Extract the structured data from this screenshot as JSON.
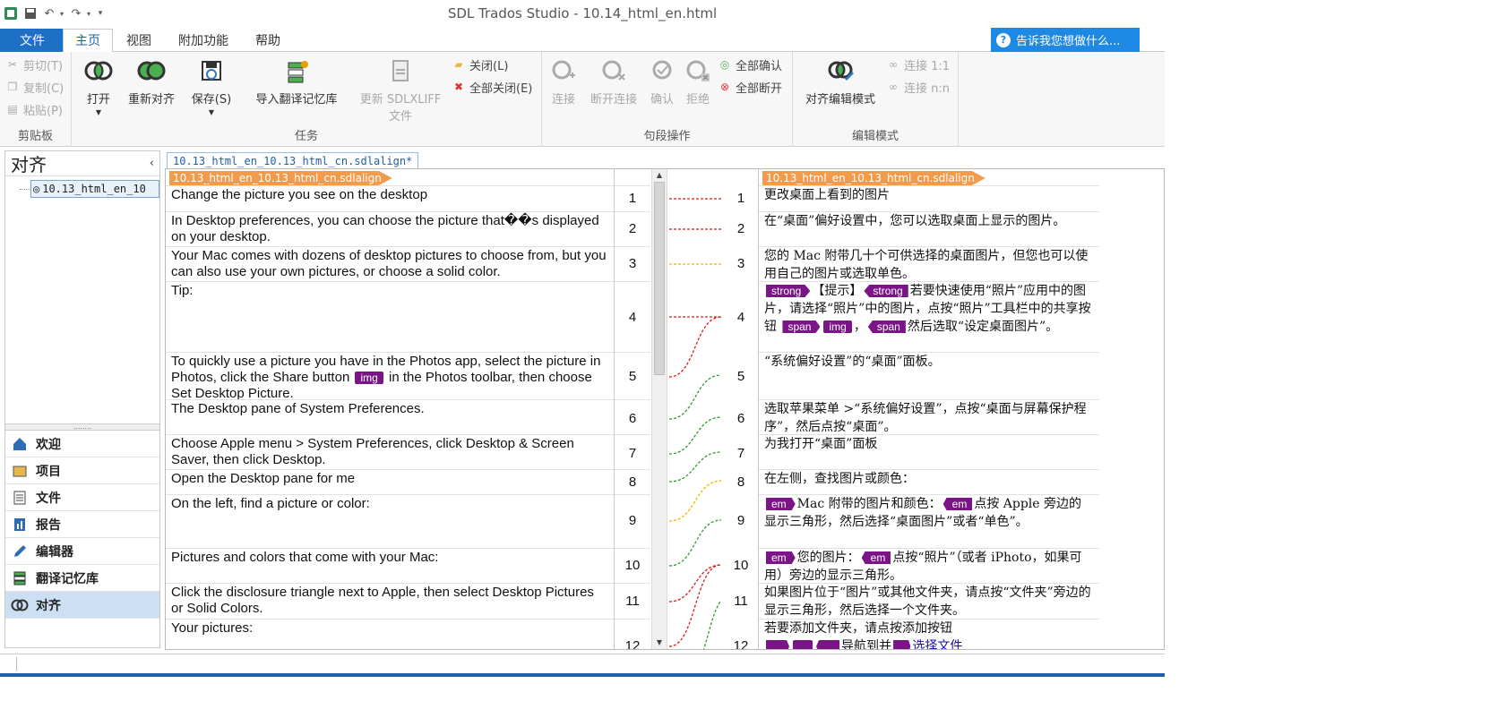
{
  "window": {
    "title": "SDL Trados Studio - 10.14_html_en.html"
  },
  "qat": {
    "undo_label": "↶",
    "redo_label": "↷",
    "more_label": "▾"
  },
  "menu": {
    "file": "文件",
    "tabs": [
      "主页",
      "视图",
      "附加功能",
      "帮助"
    ],
    "tellme": "告诉我您想做什么..."
  },
  "ribbon": {
    "clipboard": {
      "cut": "剪切(T)",
      "copy": "复制(C)",
      "paste": "粘贴(P)",
      "label": "剪贴板"
    },
    "tasks": {
      "open": "打开",
      "realign": "重新对齐",
      "save": "保存(S)",
      "import_tm": "导入翻译记忆库",
      "update_sdlxliff_1": "更新 SDLXLIFF",
      "update_sdlxliff_2": "文件",
      "close": "关闭(L)",
      "close_all": "全部关闭(E)",
      "label": "任务"
    },
    "segment_ops": {
      "connect": "连接",
      "disconnect": "断开连接",
      "confirm": "确认",
      "reject": "拒绝",
      "confirm_all": "全部确认",
      "disconnect_all": "全部断开",
      "label": "句段操作"
    },
    "edit_mode": {
      "align_edit": "对齐编辑模式",
      "connect_1_1": "连接 1:1",
      "connect_n_n": "连接 n:n",
      "label": "编辑模式"
    }
  },
  "left_panel": {
    "title": "对齐",
    "tree_item": "10.13_html_en_10",
    "splitter": "........",
    "nav": [
      "欢迎",
      "项目",
      "文件",
      "报告",
      "编辑器",
      "翻译记忆库",
      "对齐"
    ]
  },
  "doc_tab": "10.13_html_en_10.13_html_cn.sdlalign*",
  "align": {
    "source_file": "10.13_html_en_10.13_html_cn.sdlalign",
    "target_file": "10.13_html_en_10.13_html_cn.sdlalign",
    "source": [
      {
        "num": "1",
        "text": "Change the picture you see on the desktop"
      },
      {
        "num": "2",
        "text": "In Desktop preferences, you can choose the picture that��s displayed on your desktop."
      },
      {
        "num": "3",
        "text": "Your Mac comes with dozens of desktop pictures to choose from, but you can also use your own pictures, or choose a solid color."
      },
      {
        "num": "4",
        "text": "Tip:"
      },
      {
        "num": "5",
        "text_a": "To quickly use a picture you have in the Photos app, select the picture in Photos, click the Share button",
        "tag": "img",
        "text_b": " in the Photos toolbar, then choose Set Desktop Picture."
      },
      {
        "num": "6",
        "text": "The Desktop pane of System Preferences."
      },
      {
        "num": "7",
        "text": "Choose Apple menu > System Preferences, click Desktop & Screen Saver, then click Desktop."
      },
      {
        "num": "8",
        "text": "Open the Desktop pane for me"
      },
      {
        "num": "9",
        "text": "On the left, find a picture or color:"
      },
      {
        "num": "10",
        "text": "Pictures and colors that come with your Mac:"
      },
      {
        "num": "11",
        "text": "Click the disclosure triangle next to Apple, then select Desktop Pictures or Solid Colors."
      },
      {
        "num": "12",
        "text": "Your pictures:"
      }
    ],
    "target": [
      {
        "num": "1",
        "text": "更改桌面上看到的图片"
      },
      {
        "num": "2",
        "text": "在“桌面”偏好设置中，您可以选取桌面上显示的图片。"
      },
      {
        "num": "3",
        "text": "您的 Mac 附带几十个可供选择的桌面图片，但您也可以使用自己的图片或选取单色。"
      },
      {
        "num": "4",
        "tag_a": "strong",
        "text_a": "【提示】",
        "tag_b": "strong",
        "text_b": "若要快速使用“照片”应用中的图片，请选择“照片”中的图片，点按“照片”工具栏中的共享按钮",
        "tag_c": "span",
        "tag_d": "img",
        "text_c": "，",
        "tag_e": "span",
        "text_d": "然后选取“设定桌面图片”。"
      },
      {
        "num": "5",
        "text": "“系统偏好设置”的“桌面”面板。"
      },
      {
        "num": "6",
        "text": "选取苹果菜单 >“系统偏好设置”，点按“桌面与屏幕保护程序”，然后点按“桌面”。"
      },
      {
        "num": "7",
        "text": "为我打开“桌面”面板"
      },
      {
        "num": "8",
        "text": "在左侧，查找图片或颜色："
      },
      {
        "num": "9",
        "tag_a": "em",
        "text_a": "Mac 附带的图片和颜色：",
        "tag_b": "em",
        "text_b": "点按 Apple 旁边的显示三角形，然后选择“桌面图片”或者“单色”。"
      },
      {
        "num": "10",
        "tag_a": "em",
        "text_a": "您的图片：",
        "tag_b": "em",
        "text_b": "点按“照片”（或者 iPhoto，如果可用）旁边的显示三角形。"
      },
      {
        "num": "11",
        "text": "如果图片位于“图片”或其他文件夹，请点按“文件夹”旁边的显示三角形，然后选择一个文件夹。"
      },
      {
        "num": "12",
        "text_a": "若要添加文件夹，请点按添加按钮",
        "text_b": "导航到并",
        "link": "选择文件"
      }
    ]
  },
  "colors": {
    "accent": "#1e6fc6",
    "tag": "#7a1487",
    "file_flag": "#f39b4b",
    "link_red": "#d81b1b",
    "link_yellow": "#e8b800",
    "link_green": "#2e9a2e"
  }
}
